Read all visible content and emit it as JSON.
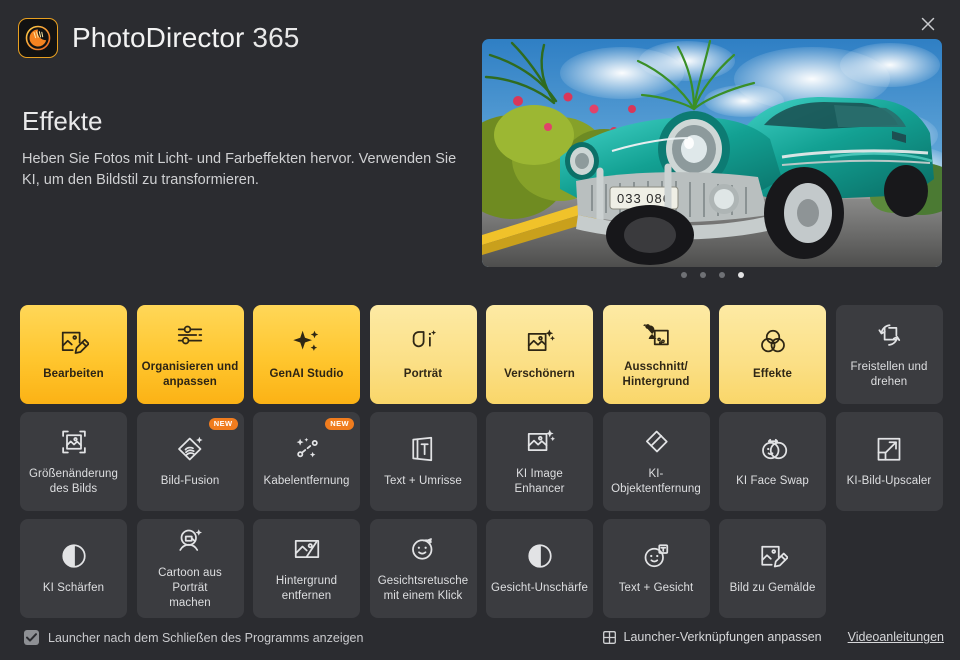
{
  "window": {
    "app_title_bold": "PhotoDirector",
    "app_title_version": "365",
    "logo_icon": "photodirector-logo-icon",
    "close_icon": "close-icon"
  },
  "promo": {
    "title": "Effekte",
    "description": "Heben Sie Fotos mit Licht- und Farbeffekten hervor. Verwenden Sie KI, um den Bildstil zu transformieren.",
    "hero_alt": "vintage-turquoise-car-photo",
    "carousel": {
      "count": 4,
      "active_index": 3
    }
  },
  "colors": {
    "background": "#2b2c30",
    "tile_dark": "#3b3c40",
    "tile_bright_top": "#ffd758",
    "tile_bright_bottom": "#fbb215",
    "tile_pale_top": "#fdeaa4",
    "tile_pale_bottom": "#f9d669",
    "badge_new": "#f07c1e",
    "accent_logo_border": "#e8a020"
  },
  "tiles": [
    {
      "label": "Bearbeiten",
      "style": "bright",
      "icon": "image-edit-icon",
      "badge": ""
    },
    {
      "label": "Organisieren und anpassen",
      "style": "bright",
      "icon": "sliders-icon",
      "badge": ""
    },
    {
      "label": "GenAI Studio",
      "style": "bright",
      "icon": "sparkles-icon",
      "badge": ""
    },
    {
      "label": "Porträt",
      "style": "pale",
      "icon": "portrait-icon",
      "badge": ""
    },
    {
      "label": "Verschönern",
      "style": "pale",
      "icon": "image-sparkle-icon",
      "badge": ""
    },
    {
      "label": "Ausschnitt/\nHintergrund",
      "style": "pale",
      "icon": "cutout-background-icon",
      "badge": ""
    },
    {
      "label": "Effekte",
      "style": "pale",
      "icon": "color-circles-icon",
      "badge": ""
    },
    {
      "label": "Freistellen und\ndrehen",
      "style": "dark",
      "icon": "crop-rotate-icon",
      "badge": ""
    },
    {
      "label": "Größenänderung\ndes Bilds",
      "style": "dark",
      "icon": "resize-image-icon",
      "badge": ""
    },
    {
      "label": "Bild-Fusion",
      "style": "dark",
      "icon": "image-fusion-icon",
      "badge": "NEW"
    },
    {
      "label": "Kabelentfernung",
      "style": "dark",
      "icon": "wire-removal-icon",
      "badge": "NEW"
    },
    {
      "label": "Text + Umrisse",
      "style": "dark",
      "icon": "text-outline-icon",
      "badge": ""
    },
    {
      "label": "KI Image Enhancer",
      "style": "dark",
      "icon": "image-enhance-icon",
      "badge": ""
    },
    {
      "label": "KI-\nObjektentfernung",
      "style": "dark",
      "icon": "eraser-icon",
      "badge": ""
    },
    {
      "label": "KI Face Swap",
      "style": "dark",
      "icon": "face-swap-icon",
      "badge": ""
    },
    {
      "label": "KI-Bild-Upscaler",
      "style": "dark",
      "icon": "upscale-icon",
      "badge": ""
    },
    {
      "label": "KI Schärfen",
      "style": "dark",
      "icon": "sharpen-icon",
      "badge": ""
    },
    {
      "label": "Cartoon aus Porträt\nmachen",
      "style": "dark",
      "icon": "cartoon-portrait-icon",
      "badge": ""
    },
    {
      "label": "Hintergrund\nentfernen",
      "style": "dark",
      "icon": "remove-background-icon",
      "badge": ""
    },
    {
      "label": "Gesichtsretusche\nmit einem Klick",
      "style": "dark",
      "icon": "face-retouch-icon",
      "badge": ""
    },
    {
      "label": "Gesicht-Unschärfe",
      "style": "dark",
      "icon": "face-blur-icon",
      "badge": ""
    },
    {
      "label": "Text + Gesicht",
      "style": "dark",
      "icon": "text-face-icon",
      "badge": ""
    },
    {
      "label": "Bild zu Gemälde",
      "style": "dark",
      "icon": "image-to-painting-icon",
      "badge": ""
    }
  ],
  "footer": {
    "checkbox_label": "Launcher nach dem Schließen des Programms anzeigen",
    "checkbox_checked": true,
    "customize_label": "Launcher-Verknüpfungen anpassen",
    "customize_icon": "grid-icon",
    "tutorials_label": "Videoanleitungen"
  }
}
